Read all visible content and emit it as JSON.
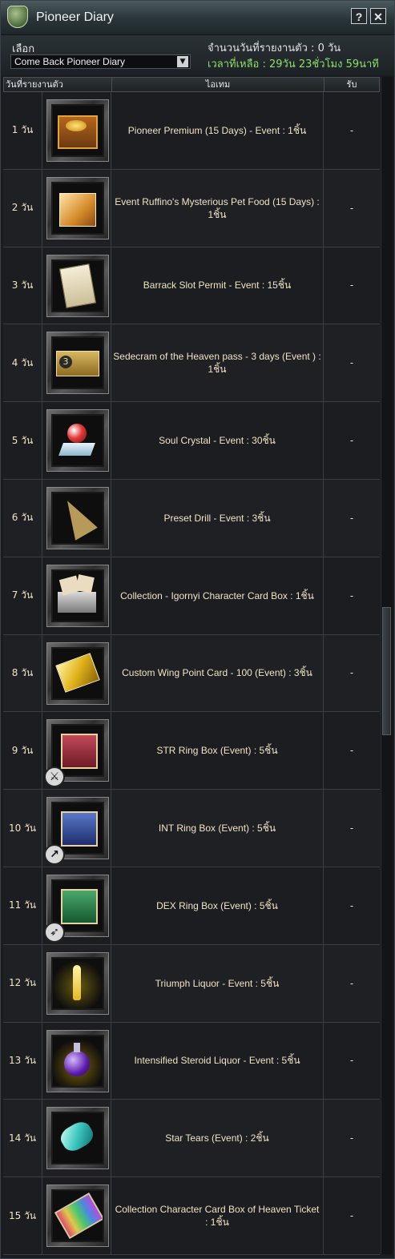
{
  "window": {
    "title": "Pioneer Diary",
    "help_label": "?",
    "close_label": "✕"
  },
  "header": {
    "select_label": "เลือก",
    "dropdown_value": "Come Back Pioneer Diary",
    "days_reported": "จำนวนวันที่รายงานตัว : 0 วัน",
    "time_left": "เวลาที่เหลือ : 29วัน 23ชั่วโมง 59นาที"
  },
  "table": {
    "columns": [
      "วันที่รายงานตัว",
      "ไอเทม",
      "รับ"
    ],
    "rows": [
      {
        "day": "1 วัน",
        "item": "Pioneer Premium (15 Days) - Event : 1ชิ้น",
        "received": "-",
        "icon": "treasure-chest-icon"
      },
      {
        "day": "2 วัน",
        "item": "Event Ruffino's Mysterious Pet Food (15 Days) : 1ชิ้น",
        "received": "-",
        "icon": "pet-food-box-icon"
      },
      {
        "day": "3 วัน",
        "item": "Barrack Slot Permit - Event : 15ชิ้น",
        "received": "-",
        "icon": "permit-scroll-icon"
      },
      {
        "day": "4 วัน",
        "item": "Sedecram of the Heaven pass - 3 days (Event ) : 1ชิ้น",
        "received": "-",
        "icon": "pass-ticket-icon"
      },
      {
        "day": "5 วัน",
        "item": "Soul Crystal - Event : 30ชิ้น",
        "received": "-",
        "icon": "soul-crystal-icon"
      },
      {
        "day": "6 วัน",
        "item": "Preset Drill - Event : 3ชิ้น",
        "received": "-",
        "icon": "drill-icon"
      },
      {
        "day": "7 วัน",
        "item": "Collection - Igornyi Character Card Box : 1ชิ้น",
        "received": "-",
        "icon": "card-box-icon"
      },
      {
        "day": "8 วัน",
        "item": "Custom Wing Point Card - 100 (Event) : 3ชิ้น",
        "received": "-",
        "icon": "wing-card-icon"
      },
      {
        "day": "9 วัน",
        "item": "STR Ring Box (Event) : 5ชิ้น",
        "received": "-",
        "icon": "str-ring-box-icon"
      },
      {
        "day": "10 วัน",
        "item": "INT Ring Box (Event) : 5ชิ้น",
        "received": "-",
        "icon": "int-ring-box-icon"
      },
      {
        "day": "11 วัน",
        "item": "DEX Ring Box (Event) : 5ชิ้น",
        "received": "-",
        "icon": "dex-ring-box-icon"
      },
      {
        "day": "12 วัน",
        "item": "Triumph Liquor - Event : 5ชิ้น",
        "received": "-",
        "icon": "liquor-bottle-icon"
      },
      {
        "day": "13 วัน",
        "item": "Intensified Steroid Liquor - Event : 5ชิ้น",
        "received": "-",
        "icon": "potion-flask-icon"
      },
      {
        "day": "14 วัน",
        "item": "Star Tears (Event) : 2ชิ้น",
        "received": "-",
        "icon": "star-tears-gem-icon"
      },
      {
        "day": "15 วัน",
        "item": "Collection Character Card Box of Heaven Ticket : 1ชิ้น",
        "received": "-",
        "icon": "heaven-ticket-icon"
      }
    ]
  },
  "colors": {
    "cell_text": "#f1e3c4",
    "time_left_text": "#8fe06a",
    "background": "#1b1d20"
  }
}
